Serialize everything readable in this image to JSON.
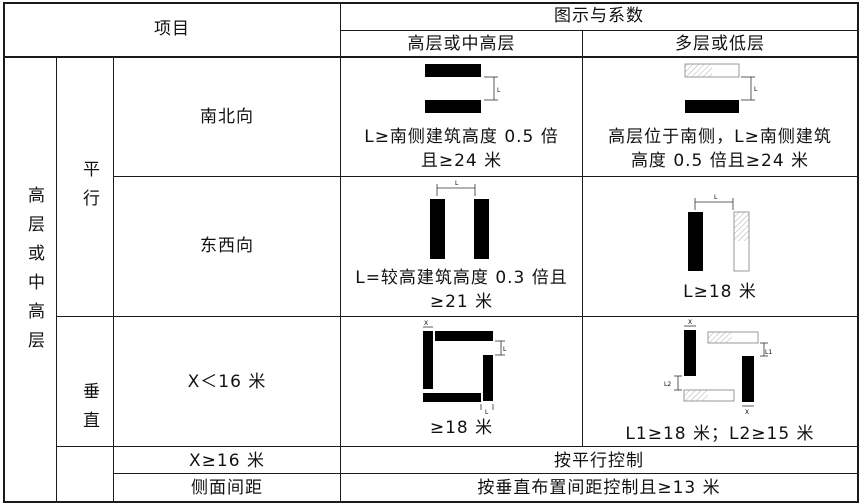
{
  "header": {
    "item": "项目",
    "figure_and_coefficient": "图示与系数",
    "col_high": "高层或中高层",
    "col_multi": "多层或低层"
  },
  "row_group": {
    "category": "高层或中高层",
    "parallel": "平行",
    "perpendicular": "垂直"
  },
  "rows": {
    "north_south": {
      "label": "南北向",
      "high_text_1": "L≥南侧建筑高度 0.5 倍",
      "high_text_2": "且≥24 米",
      "multi_text_1": "高层位于南侧，L≥南侧建筑",
      "multi_text_2": "高度 0.5 倍且≥24 米"
    },
    "east_west": {
      "label": "东西向",
      "high_text_1": "L=较高建筑高度 0.3 倍且",
      "high_text_2": "≥21 米",
      "multi_text": "L≥18 米"
    },
    "perp": {
      "label": "X＜16 米",
      "high_text": "≥18 米",
      "multi_text": "L1≥18 米；L2≥15 米"
    },
    "x_ge16": {
      "label": "X≥16 米",
      "value": "按平行控制"
    },
    "side_spacing": {
      "label": "侧面间距",
      "value": "按垂直布置间距控制且≥13 米"
    }
  },
  "diagram_labels": {
    "L": "L",
    "L1": "L1",
    "L2": "L2",
    "X": "X"
  }
}
